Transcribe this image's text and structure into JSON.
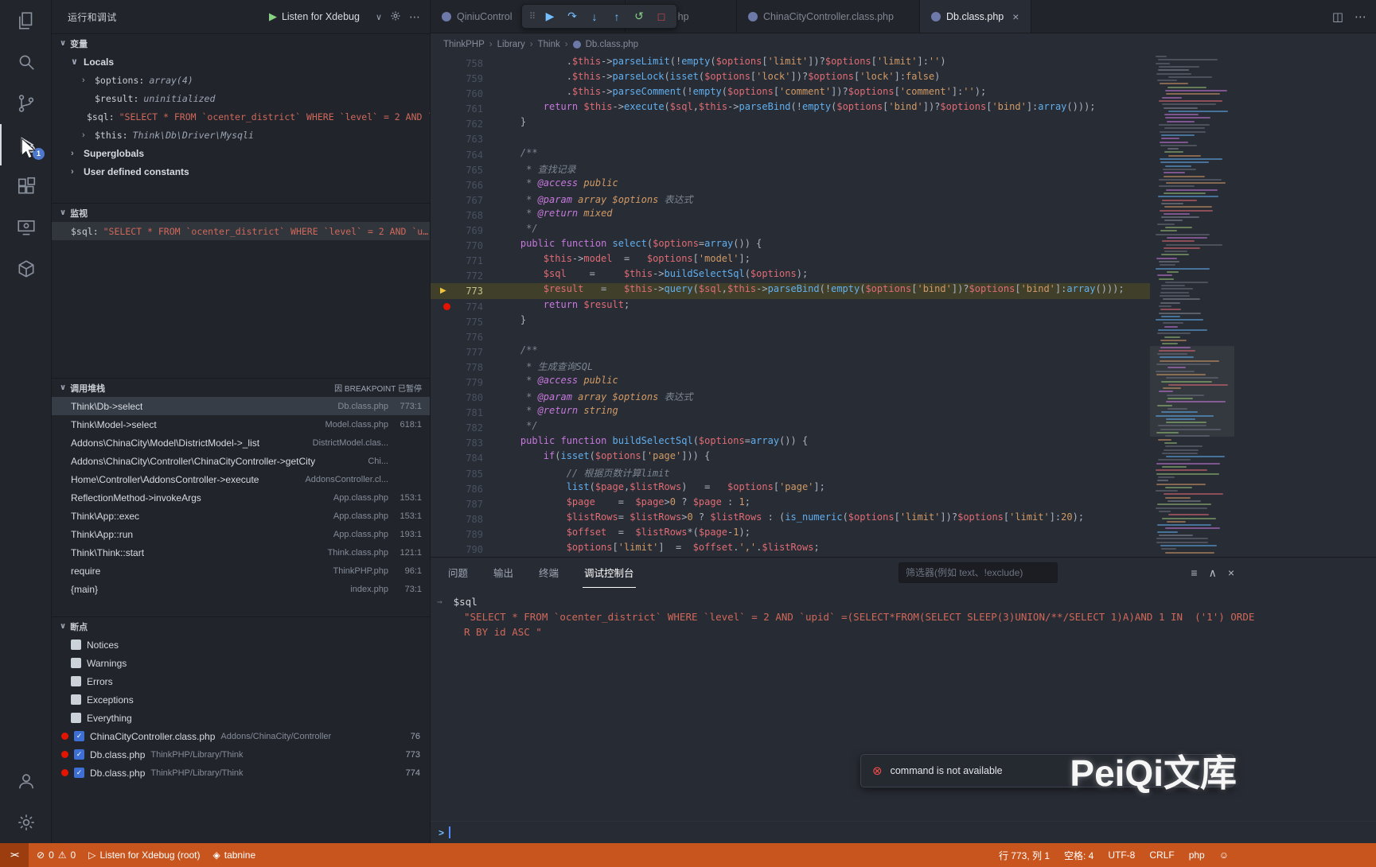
{
  "app": {
    "watermark": "PeiQi文库"
  },
  "activity_bar": {
    "badge": "1"
  },
  "sidebar": {
    "title": "运行和调试",
    "debug_dropdown": {
      "label": "Listen for Xdebug"
    },
    "variables": {
      "title": "变量",
      "locals_label": "Locals",
      "rows": [
        {
          "chev": "›",
          "name": "$options:",
          "value": "array(4)",
          "vclass": "meta"
        },
        {
          "chev": "",
          "name": "$result:",
          "value": "uninitialized",
          "vclass": "meta"
        },
        {
          "chev": "",
          "name": "$sql:",
          "value": "\"SELECT * FROM `ocenter_district` WHERE `level` = 2 AND `…",
          "vclass": "str"
        },
        {
          "chev": "›",
          "name": "$this:",
          "value": "Think\\Db\\Driver\\Mysqli",
          "vclass": "meta"
        }
      ],
      "groups": [
        {
          "chev": "›",
          "label": "Superglobals"
        },
        {
          "chev": "›",
          "label": "User defined constants"
        }
      ]
    },
    "watch": {
      "title": "监视",
      "rows": [
        {
          "name": "$sql:",
          "value": "\"SELECT * FROM `ocenter_district` WHERE `level` = 2 AND `u…",
          "vclass": "str",
          "selected": true
        }
      ]
    },
    "call_stack": {
      "title": "调用堆栈",
      "badge": "因 BREAKPOINT 已暂停",
      "frames": [
        {
          "name": "Think\\Db->select",
          "file": "Db.class.php",
          "line": "773:1",
          "selected": true
        },
        {
          "name": "Think\\Model->select",
          "file": "Model.class.php",
          "line": "618:1"
        },
        {
          "name": "Addons\\ChinaCity\\Model\\DistrictModel->_list",
          "file": "DistrictModel.clas...",
          "line": ""
        },
        {
          "name": "Addons\\ChinaCity\\Controller\\ChinaCityController->getCity",
          "file": "Chi...",
          "line": ""
        },
        {
          "name": "Home\\Controller\\AddonsController->execute",
          "file": "AddonsController.cl...",
          "line": ""
        },
        {
          "name": "ReflectionMethod->invokeArgs",
          "file": "App.class.php",
          "line": "153:1"
        },
        {
          "name": "Think\\App::exec",
          "file": "App.class.php",
          "line": "153:1"
        },
        {
          "name": "Think\\App::run",
          "file": "App.class.php",
          "line": "193:1"
        },
        {
          "name": "Think\\Think::start",
          "file": "Think.class.php",
          "line": "121:1"
        },
        {
          "name": "require",
          "file": "ThinkPHP.php",
          "line": "96:1"
        },
        {
          "name": "{main}",
          "file": "index.php",
          "line": "73:1"
        }
      ]
    },
    "breakpoints": {
      "title": "断点",
      "toggles": [
        "Notices",
        "Warnings",
        "Errors",
        "Exceptions",
        "Everything"
      ],
      "files": [
        {
          "file": "ChinaCityController.class.php",
          "path": "Addons/ChinaCity/Controller",
          "line": "76"
        },
        {
          "file": "Db.class.php",
          "path": "ThinkPHP/Library/Think",
          "line": "773"
        },
        {
          "file": "Db.class.php",
          "path": "ThinkPHP/Library/Think",
          "line": "774"
        }
      ]
    }
  },
  "editor_tabs": [
    {
      "label": "QiniuControl",
      "active": false
    },
    {
      "label": "lass.php",
      "active": false
    },
    {
      "label": "ChinaCityController.class.php",
      "active": false
    },
    {
      "label": "Db.class.php",
      "active": true
    }
  ],
  "debug_toolbar": [
    {
      "name": "drag-handle",
      "glyph": "⠿",
      "cls": "grip"
    },
    {
      "name": "continue-button",
      "glyph": "▶",
      "cls": "blue"
    },
    {
      "name": "step-over-button",
      "glyph": "↷",
      "cls": "blue"
    },
    {
      "name": "step-into-button",
      "glyph": "↓",
      "cls": "blue"
    },
    {
      "name": "step-out-button",
      "glyph": "↑",
      "cls": "blue"
    },
    {
      "name": "restart-button",
      "glyph": "↺",
      "cls": "green"
    },
    {
      "name": "stop-button",
      "glyph": "□",
      "cls": "red"
    }
  ],
  "breadcrumb": [
    "ThinkPHP",
    "Library",
    "Think",
    "Db.class.php"
  ],
  "editor": {
    "current_line": 773,
    "breakpoint_lines": [
      774
    ],
    "lines": [
      {
        "n": 758,
        "t": "            .$this->parseLimit(!empty($options['limit'])?$options['limit']:'')"
      },
      {
        "n": 759,
        "t": "            .$this->parseLock(isset($options['lock'])?$options['lock']:false)"
      },
      {
        "n": 760,
        "t": "            .$this->parseComment(!empty($options['comment'])?$options['comment']:'');"
      },
      {
        "n": 761,
        "t": "        return $this->execute($sql,$this->parseBind(!empty($options['bind'])?$options['bind']:array()));"
      },
      {
        "n": 762,
        "t": "    }"
      },
      {
        "n": 763,
        "t": ""
      },
      {
        "n": 764,
        "t": "    /**"
      },
      {
        "n": 765,
        "t": "     * 查找记录"
      },
      {
        "n": 766,
        "t": "     * @access public"
      },
      {
        "n": 767,
        "t": "     * @param array $options 表达式"
      },
      {
        "n": 768,
        "t": "     * @return mixed"
      },
      {
        "n": 769,
        "t": "     */"
      },
      {
        "n": 770,
        "t": "    public function select($options=array()) {"
      },
      {
        "n": 771,
        "t": "        $this->model  =   $options['model'];"
      },
      {
        "n": 772,
        "t": "        $sql    =     $this->buildSelectSql($options);"
      },
      {
        "n": 773,
        "t": "        $result   =   $this->query($sql,$this->parseBind(!empty($options['bind'])?$options['bind']:array()));"
      },
      {
        "n": 774,
        "t": "        return $result;"
      },
      {
        "n": 775,
        "t": "    }"
      },
      {
        "n": 776,
        "t": ""
      },
      {
        "n": 777,
        "t": "    /**"
      },
      {
        "n": 778,
        "t": "     * 生成查询SQL"
      },
      {
        "n": 779,
        "t": "     * @access public"
      },
      {
        "n": 780,
        "t": "     * @param array $options 表达式"
      },
      {
        "n": 781,
        "t": "     * @return string"
      },
      {
        "n": 782,
        "t": "     */"
      },
      {
        "n": 783,
        "t": "    public function buildSelectSql($options=array()) {"
      },
      {
        "n": 784,
        "t": "        if(isset($options['page'])) {"
      },
      {
        "n": 785,
        "t": "            // 根据页数计算limit"
      },
      {
        "n": 786,
        "t": "            list($page,$listRows)   =   $options['page'];"
      },
      {
        "n": 787,
        "t": "            $page    =  $page>0 ? $page : 1;"
      },
      {
        "n": 788,
        "t": "            $listRows= $listRows>0 ? $listRows : (is_numeric($options['limit'])?$options['limit']:20);"
      },
      {
        "n": 789,
        "t": "            $offset  =  $listRows*($page-1);"
      },
      {
        "n": 790,
        "t": "            $options['limit']  =  $offset.','.$listRows;"
      }
    ]
  },
  "panel": {
    "tabs": [
      "问题",
      "输出",
      "终端",
      "调试控制台"
    ],
    "active_tab": "调试控制台",
    "filter_placeholder": "筛选器(例如 text、!exclude)",
    "console": {
      "expression": "$sql",
      "result_lines": [
        "\"SELECT * FROM `ocenter_district` WHERE `level` = 2 AND `upid` =(SELECT*FROM(SELECT SLEEP(3)UNION/**/SELECT 1)A)AND 1 IN  ('1') ORDE",
        "R BY id ASC \""
      ]
    },
    "notification": "command is not available"
  },
  "status_bar": {
    "errors": "0",
    "warnings": "0",
    "debug_status": "Listen for Xdebug (root)",
    "tabnine": "tabnine",
    "line_col": "行 773, 列 1",
    "spaces": "空格: 4",
    "encoding": "UTF-8",
    "eol": "CRLF",
    "language": "php"
  }
}
